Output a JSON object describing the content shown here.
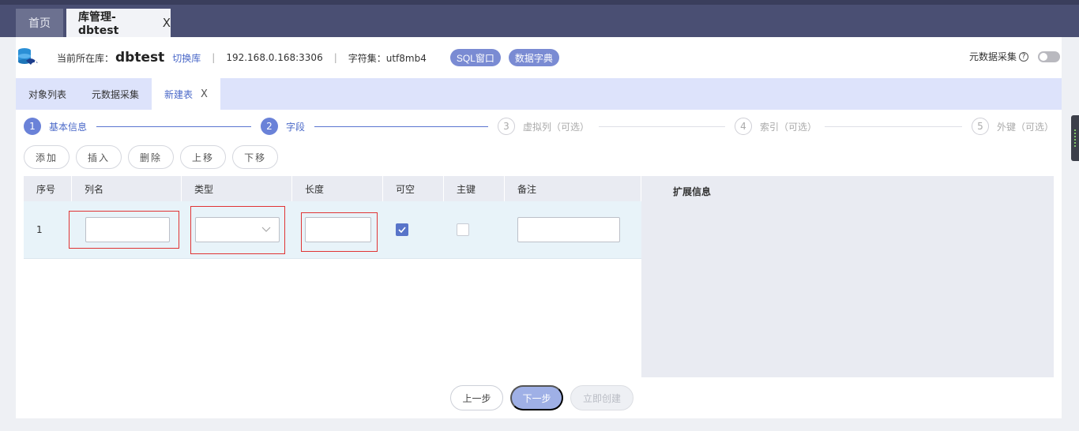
{
  "top_tabs": [
    {
      "label": "首页"
    },
    {
      "label": "库管理-dbtest",
      "close": "X"
    }
  ],
  "info": {
    "current_label": "当前所在库：",
    "db_name": "dbtest",
    "switch_label": "切换库",
    "sep": "|",
    "host": "192.168.0.168:3306",
    "charset": "字符集：utf8mb4",
    "sql_window_label": "SQL窗口",
    "data_dict_label": "数据字典",
    "meta_collect_label": "元数据采集",
    "help_icon": "?",
    "meta_toggle_on": false
  },
  "sub_tabs": [
    {
      "label": "对象列表"
    },
    {
      "label": "元数据采集"
    },
    {
      "label": "新建表",
      "close": "X"
    }
  ],
  "steps": [
    {
      "num": "1",
      "label": "基本信息",
      "state": "done"
    },
    {
      "num": "2",
      "label": "字段",
      "state": "done"
    },
    {
      "num": "3",
      "label": "虚拟列（可选）",
      "state": "todo"
    },
    {
      "num": "4",
      "label": "索引（可选）",
      "state": "todo"
    },
    {
      "num": "5",
      "label": "外键（可选）",
      "state": "todo"
    }
  ],
  "actions": [
    "添加",
    "插入",
    "删除",
    "上移",
    "下移"
  ],
  "table": {
    "headers": [
      "序号",
      "列名",
      "类型",
      "长度",
      "可空",
      "主键",
      "备注"
    ],
    "rows": [
      {
        "index": "1",
        "name": "",
        "type": "",
        "length": "",
        "nullable": true,
        "primary_key": false,
        "comment": ""
      }
    ]
  },
  "ext_panel": {
    "title": "扩展信息"
  },
  "footer": {
    "prev_label": "上一步",
    "next_label": "下一步",
    "create_label": "立即创建"
  },
  "colors": {
    "accent": "#6a82d8",
    "topbar": "#4a4f73",
    "subtab_bg": "#dde3fb",
    "error_border": "#e03434"
  }
}
